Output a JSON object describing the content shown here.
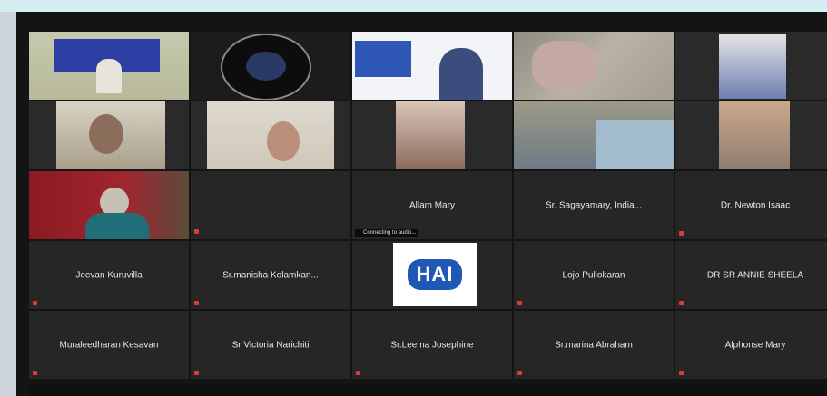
{
  "participants": [
    {
      "label": "",
      "center": "",
      "muted": false
    },
    {
      "label": "",
      "center": "",
      "muted": false
    },
    {
      "label": "",
      "center": "",
      "muted": false
    },
    {
      "label": "",
      "center": "",
      "muted": false
    },
    {
      "label": "",
      "center": "",
      "muted": false
    },
    {
      "label": "",
      "center": "",
      "muted": false
    },
    {
      "label": "",
      "center": "",
      "muted": false
    },
    {
      "label": "",
      "center": "",
      "muted": false
    },
    {
      "label": "",
      "center": "",
      "muted": false
    },
    {
      "label": "",
      "center": "",
      "muted": false
    },
    {
      "label": "",
      "center": "",
      "muted": false
    },
    {
      "label": "",
      "center": "",
      "muted": true
    },
    {
      "label": "Connecting to audio...",
      "center": "Allam Mary",
      "muted": false
    },
    {
      "label": "",
      "center": "Sr. Sagayamary, India...",
      "muted": false
    },
    {
      "label": "",
      "center": "Dr. Newton Isaac",
      "muted": true
    },
    {
      "label": "",
      "center": "Jeevan Kuruvilla",
      "muted": true
    },
    {
      "label": "",
      "center": "Sr.manisha Kolamkan...",
      "muted": true
    },
    {
      "label": "",
      "center": "",
      "muted": false,
      "logo": "HAI"
    },
    {
      "label": "",
      "center": "Lojo Pullokaran",
      "muted": true
    },
    {
      "label": "",
      "center": "DR SR ANNIE SHEELA",
      "muted": true
    },
    {
      "label": "",
      "center": "Muraleedharan Kesavan",
      "muted": true
    },
    {
      "label": "",
      "center": "Sr Victoria Narichiti",
      "muted": true
    },
    {
      "label": "",
      "center": "Sr.Leema Josephine",
      "muted": true
    },
    {
      "label": "",
      "center": "Sr.marina Abraham",
      "muted": true
    },
    {
      "label": "",
      "center": "Alphonse Mary",
      "muted": true
    }
  ]
}
